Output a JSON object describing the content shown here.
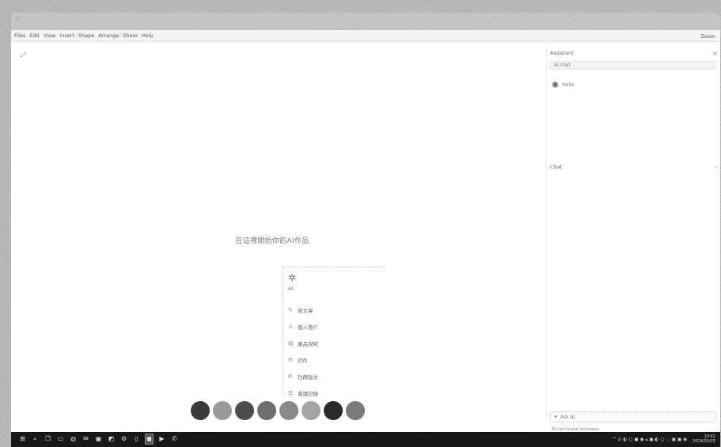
{
  "window": {
    "title": "................",
    "traffic_label": "○"
  },
  "menubar": {
    "items": [
      "Files",
      "Edit",
      "View",
      "Insert",
      "Shape",
      "Arrange",
      "Share",
      "Help"
    ],
    "right_label": "Zoom"
  },
  "canvas": {
    "expand_icon": "expand-icon",
    "center_prompt": "在這裡開始你的AI作品",
    "dropdown": {
      "head_icon": "sparkle-icon",
      "head_label": "AI",
      "items": [
        {
          "icon": "pencil-icon",
          "label": "寫文章"
        },
        {
          "icon": "person-icon",
          "label": "個人簡介"
        },
        {
          "icon": "document-icon",
          "label": "產品說明"
        },
        {
          "icon": "mail-icon",
          "label": "信件"
        },
        {
          "icon": "chat-icon",
          "label": "社群貼文"
        },
        {
          "icon": "list-icon",
          "label": "會議記錄"
        }
      ]
    },
    "color_swatches": [
      "#3b3b3b",
      "#9a9a9a",
      "#4d4d4d",
      "#6e6e6e",
      "#8a8a8a",
      "#a5a5a5",
      "#2a2a2a",
      "#7a7a7a"
    ]
  },
  "panel": {
    "header": "Assistant",
    "close_icon": "close-icon",
    "field_text": "AI chat",
    "avatar_label": "Hello",
    "section_label": "Chat",
    "input_placeholder": "Ask AI",
    "footer": "AI can make mistakes"
  },
  "taskbar": {
    "left_icons": [
      "start-icon",
      "search-icon",
      "taskview-icon",
      "folder-icon",
      "browser-icon",
      "mail-icon",
      "store-icon",
      "photos-icon",
      "settings-icon",
      "terminal-icon",
      "app-icon",
      "media-icon",
      "chat-icon"
    ],
    "active_index": 10,
    "right_text": "^ ⊙ ◐ ◻ ◼ ◉ ▴ ◼ ◐ ◻ ◌ ▣ ◼ ◉",
    "clock_time": "10:42",
    "clock_date": "2024/01/15"
  }
}
